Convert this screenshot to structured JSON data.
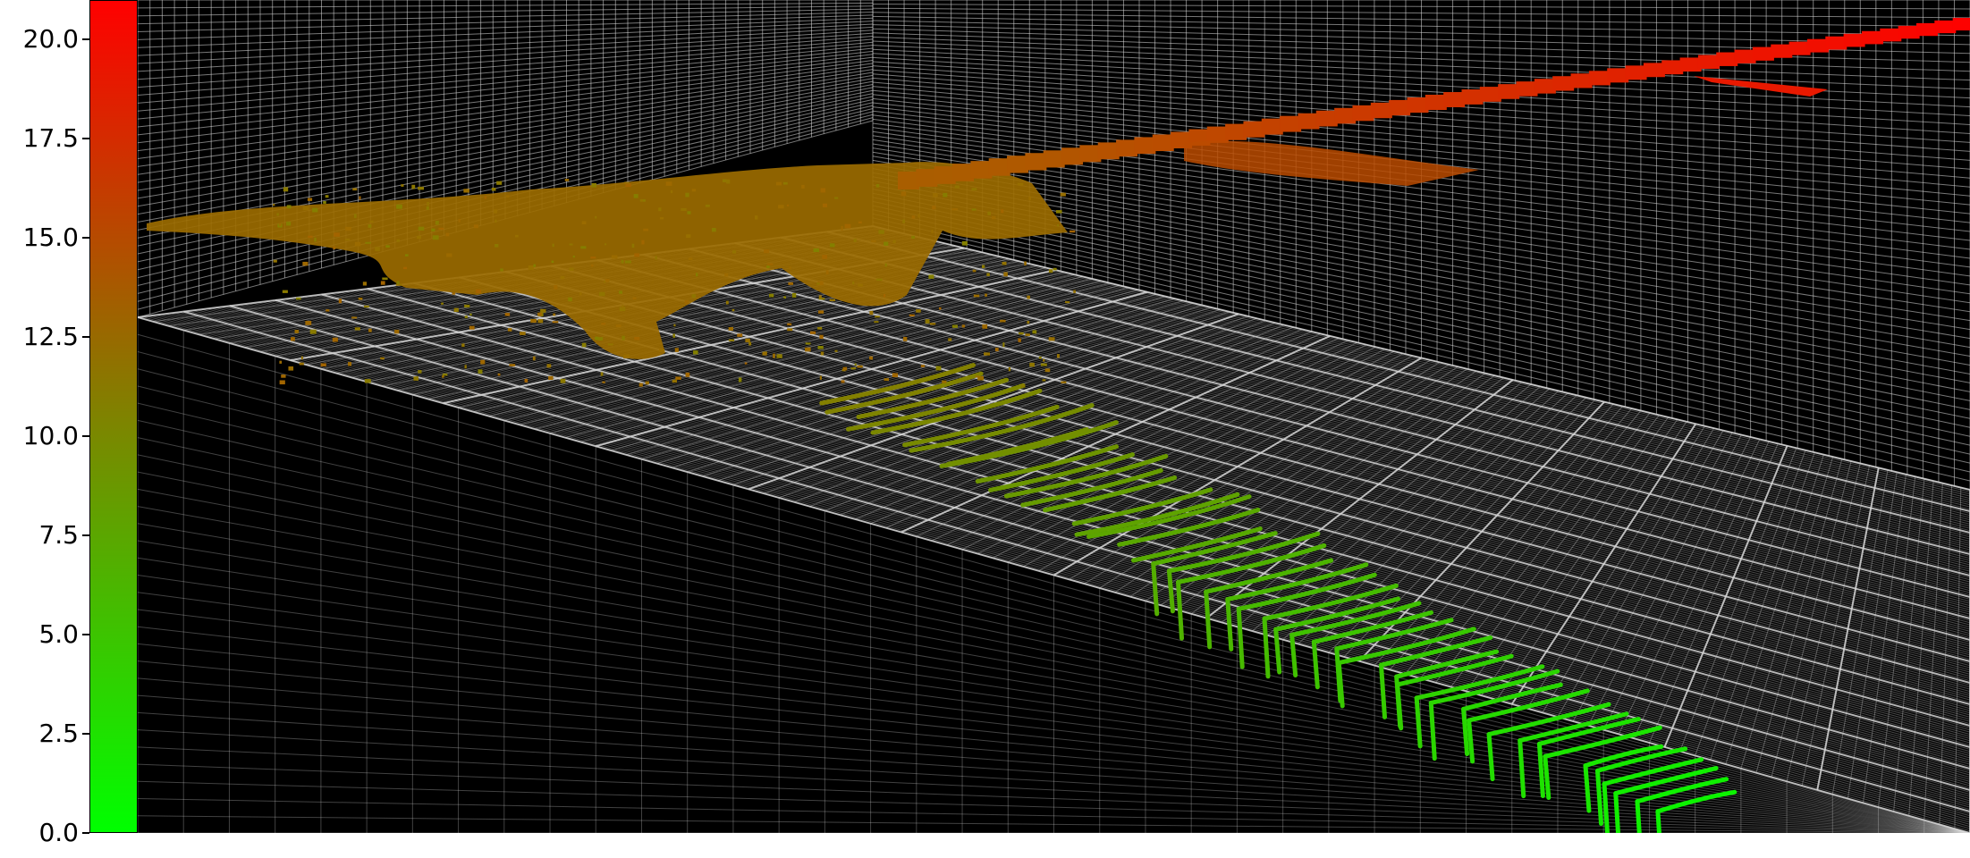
{
  "chart_data": {
    "type": "scatter",
    "title": "",
    "colorbar": {
      "ticks": [
        "0.0",
        "2.5",
        "5.0",
        "7.5",
        "10.0",
        "12.5",
        "15.0",
        "17.5",
        "20.0"
      ],
      "tick_values": [
        0,
        2.5,
        5,
        7.5,
        10,
        12.5,
        15,
        17.5,
        20
      ],
      "range": [
        0,
        21
      ],
      "color_low": "#00ff00",
      "color_high": "#ff0000"
    },
    "grid": true,
    "background": "#000000",
    "grid_color": "#d8d8d8",
    "description_series": [
      {
        "name": "",
        "z_range": [
          0,
          21
        ],
        "branches": [
          {
            "from_z": 0,
            "to_z": 12,
            "shape": "ribbed corridor"
          },
          {
            "from_z": 12,
            "to_z": 15,
            "shape": "junction plateau"
          },
          {
            "from_z": 15,
            "to_z": 21,
            "shape": "rising ramp"
          }
        ]
      }
    ]
  }
}
